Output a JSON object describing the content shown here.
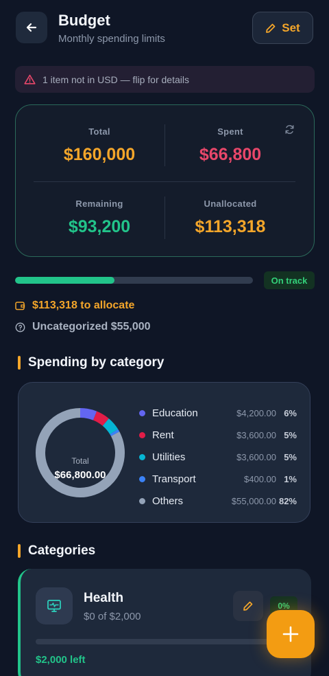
{
  "header": {
    "title": "Budget",
    "subtitle": "Monthly spending limits",
    "set_label": "Set"
  },
  "warning": {
    "text": "1 item not in USD — flip for details"
  },
  "summary": {
    "total_label": "Total",
    "total_value": "$160,000",
    "spent_label": "Spent",
    "spent_value": "$66,800",
    "remaining_label": "Remaining",
    "remaining_value": "$93,200",
    "unallocated_label": "Unallocated",
    "unallocated_value": "$113,318"
  },
  "progress": {
    "fraction": 0.418,
    "status": "On track"
  },
  "allocate": {
    "text": "$113,318 to allocate"
  },
  "uncategorized": {
    "text": "Uncategorized $55,000"
  },
  "spending_section": {
    "title": "Spending by category"
  },
  "chart_data": {
    "type": "pie",
    "center_label": "Total",
    "center_value": "$66,800.00",
    "slices": [
      {
        "name": "Education",
        "amount": "$4,200.00",
        "pct_label": "6%",
        "value": 6,
        "color": "#6366f1"
      },
      {
        "name": "Rent",
        "amount": "$3,600.00",
        "pct_label": "5%",
        "value": 5,
        "color": "#e11d48"
      },
      {
        "name": "Utilities",
        "amount": "$3,600.00",
        "pct_label": "5%",
        "value": 5,
        "color": "#06b6d4"
      },
      {
        "name": "Transport",
        "amount": "$400.00",
        "pct_label": "1%",
        "value": 1,
        "color": "#3b82f6"
      },
      {
        "name": "Others",
        "amount": "$55,000.00",
        "pct_label": "82%",
        "value": 82,
        "color": "#94a3b8"
      }
    ]
  },
  "categories_section": {
    "title": "Categories"
  },
  "category": {
    "name": "Health",
    "amount": "$0 of $2,000",
    "pct": "0%",
    "left": "$2,000 left",
    "progress": 0
  },
  "colors": {
    "accent": "#f4a62a",
    "total": "#f4a62a",
    "spent": "#e8476a",
    "remaining": "#22c48a",
    "unallocated": "#f4a62a",
    "fab": "#f39c12"
  },
  "icons": {
    "back": "arrow-left-icon",
    "set": "pencil-icon",
    "warning": "alert-triangle-icon",
    "refresh": "refresh-icon",
    "wallet": "wallet-icon",
    "help": "question-circle-icon",
    "category": "monitor-heart-icon",
    "edit": "pencil-icon",
    "fab": "plus-icon"
  }
}
